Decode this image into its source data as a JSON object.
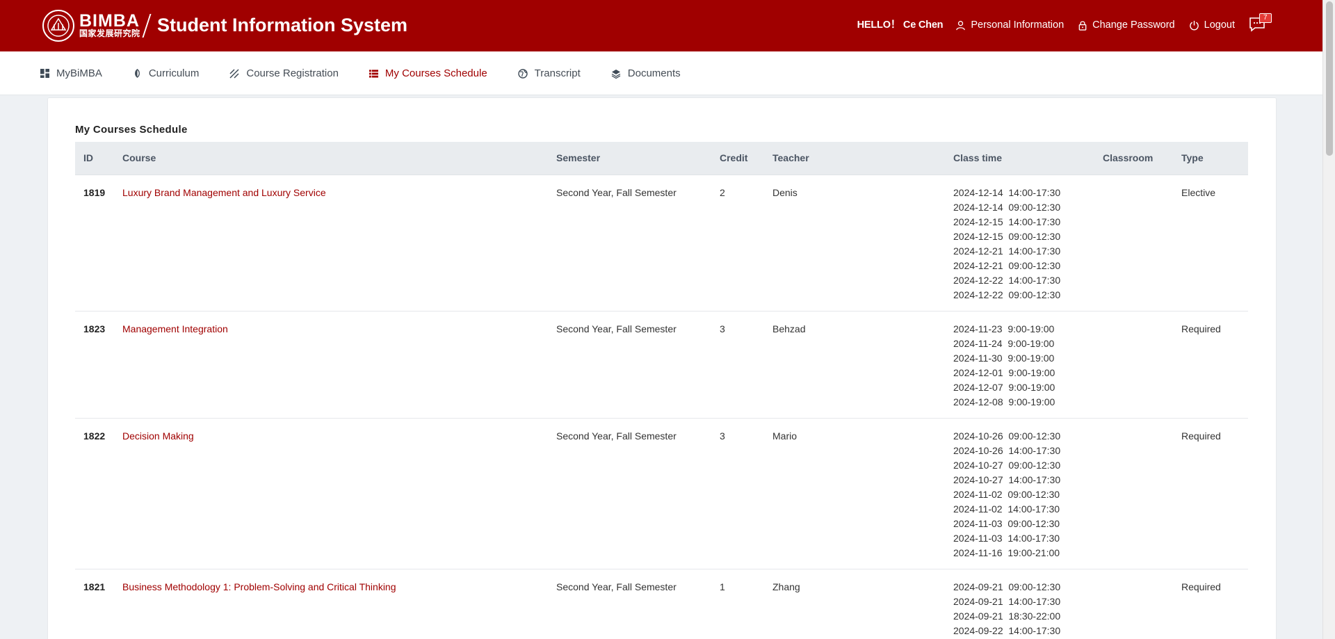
{
  "header": {
    "logo_text": "BIMBA",
    "logo_cn": "国家发展研究院",
    "app_title": "Student Information System",
    "greeting": "HELLO！ Ce Chen",
    "personal_info": "Personal Information",
    "change_password": "Change Password",
    "logout": "Logout",
    "message_count": "7"
  },
  "nav": {
    "items": [
      {
        "label": "MyBiMBA",
        "icon": "dashboard-icon"
      },
      {
        "label": "Curriculum",
        "icon": "contrast-icon"
      },
      {
        "label": "Course Registration",
        "icon": "hatch-icon"
      },
      {
        "label": "My Courses Schedule",
        "icon": "list-icon"
      },
      {
        "label": "Transcript",
        "icon": "globe-icon"
      },
      {
        "label": "Documents",
        "icon": "layers-icon"
      }
    ],
    "active_index": 3
  },
  "main": {
    "title": "My Courses Schedule",
    "columns": [
      "ID",
      "Course",
      "Semester",
      "Credit",
      "Teacher",
      "Class time",
      "Classroom",
      "Type"
    ],
    "rows": [
      {
        "id": "1819",
        "course": "Luxury Brand Management and Luxury Service",
        "semester": "Second Year, Fall Semester",
        "credit": "2",
        "teacher": "Denis",
        "times": [
          "2024-12-14  14:00-17:30",
          "2024-12-14  09:00-12:30",
          "2024-12-15  14:00-17:30",
          "2024-12-15  09:00-12:30",
          "2024-12-21  14:00-17:30",
          "2024-12-21  09:00-12:30",
          "2024-12-22  14:00-17:30",
          "2024-12-22  09:00-12:30"
        ],
        "classroom": "",
        "type": "Elective"
      },
      {
        "id": "1823",
        "course": "Management Integration",
        "semester": "Second Year, Fall Semester",
        "credit": "3",
        "teacher": "Behzad",
        "times": [
          "2024-11-23  9:00-19:00",
          "2024-11-24  9:00-19:00",
          "2024-11-30  9:00-19:00",
          "2024-12-01  9:00-19:00",
          "2024-12-07  9:00-19:00",
          "2024-12-08  9:00-19:00"
        ],
        "classroom": "",
        "type": "Required"
      },
      {
        "id": "1822",
        "course": "Decision Making",
        "semester": "Second Year, Fall Semester",
        "credit": "3",
        "teacher": "Mario",
        "times": [
          "2024-10-26  09:00-12:30",
          "2024-10-26  14:00-17:30",
          "2024-10-27  09:00-12:30",
          "2024-10-27  14:00-17:30",
          "2024-11-02  09:00-12:30",
          "2024-11-02  14:00-17:30",
          "2024-11-03  09:00-12:30",
          "2024-11-03  14:00-17:30",
          "2024-11-16  19:00-21:00"
        ],
        "classroom": "",
        "type": "Required"
      },
      {
        "id": "1821",
        "course": "Business Methodology 1: Problem-Solving and Critical Thinking",
        "semester": "Second Year, Fall Semester",
        "credit": "1",
        "teacher": "Zhang",
        "times": [
          "2024-09-21  09:00-12:30",
          "2024-09-21  14:00-17:30",
          "2024-09-21  18:30-22:00",
          "2024-09-22  14:00-17:30"
        ],
        "classroom": "",
        "type": "Required"
      }
    ]
  },
  "colors": {
    "brand": "#a00000",
    "background": "#eef1f4",
    "table_header": "#e9ecef"
  }
}
